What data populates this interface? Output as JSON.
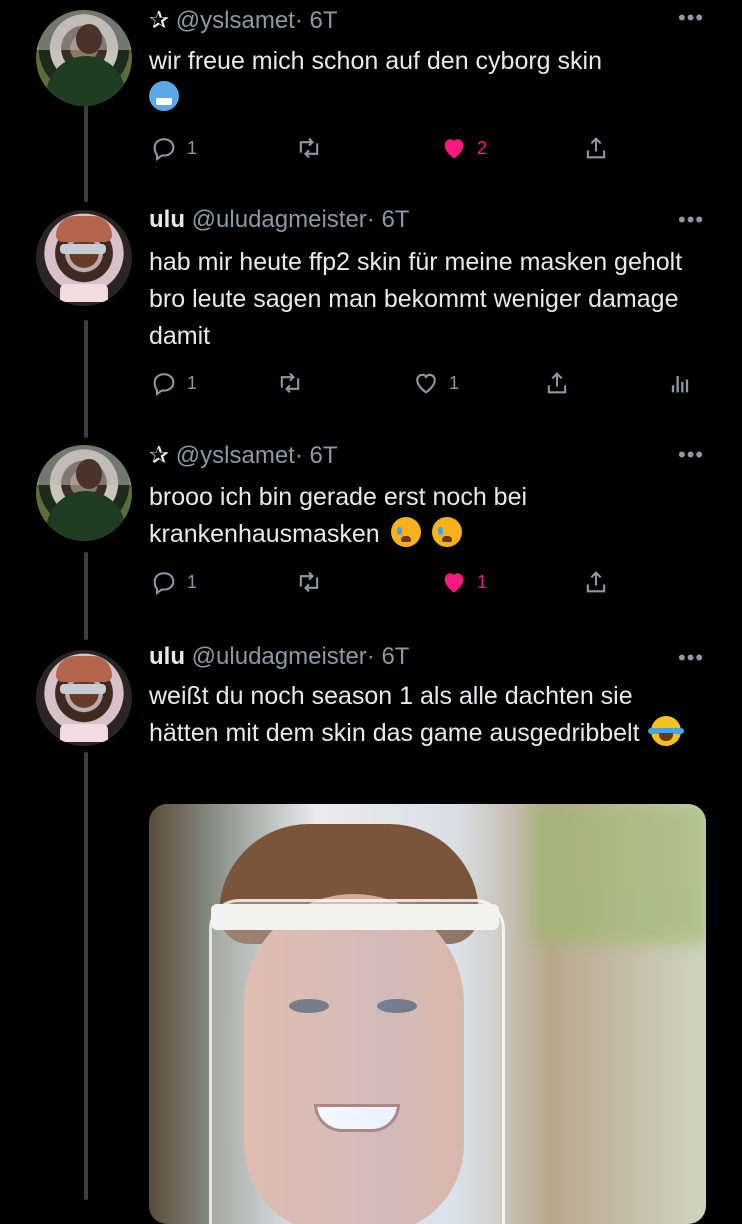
{
  "tweets": [
    {
      "display_name": "",
      "star": "✰",
      "handle": "@yslsamet",
      "time": "· 6T",
      "text": "wir freue mich schon auf den cyborg skin",
      "emoji": [
        "cold-face"
      ],
      "replies": "1",
      "retweets": "",
      "likes": "2",
      "liked": true,
      "show_analytics": false
    },
    {
      "display_name": "ulu",
      "star": "",
      "handle": "@uludagmeister",
      "time": "· 6T",
      "text": "hab mir heute ffp2 skin für meine masken geholt bro leute sagen man bekommt weniger damage damit",
      "emoji": [],
      "replies": "1",
      "retweets": "",
      "likes": "1",
      "liked": false,
      "show_analytics": true
    },
    {
      "display_name": "",
      "star": "✰",
      "handle": "@yslsamet",
      "time": "· 6T",
      "text": "brooo ich bin gerade erst noch bei krankenhausmasken",
      "emoji": [
        "crying-cat",
        "crying-cat"
      ],
      "replies": "1",
      "retweets": "",
      "likes": "1",
      "liked": true,
      "show_analytics": false
    },
    {
      "display_name": "ulu",
      "star": "",
      "handle": "@uludagmeister",
      "time": "· 6T",
      "text": "weißt du noch season 1 als alle dachten sie hätten mit dem skin das game ausgedribbelt",
      "emoji": [
        "tears-of-joy"
      ],
      "media": "photo-face-shield"
    }
  ],
  "colors": {
    "background": "#000000",
    "text": "#e7e9ea",
    "muted": "#8b98a5",
    "like": "#f91880",
    "thread_line": "#3a3f44"
  },
  "icons": [
    "reply-icon",
    "retweet-icon",
    "like-icon",
    "share-icon",
    "analytics-icon",
    "more-icon"
  ]
}
